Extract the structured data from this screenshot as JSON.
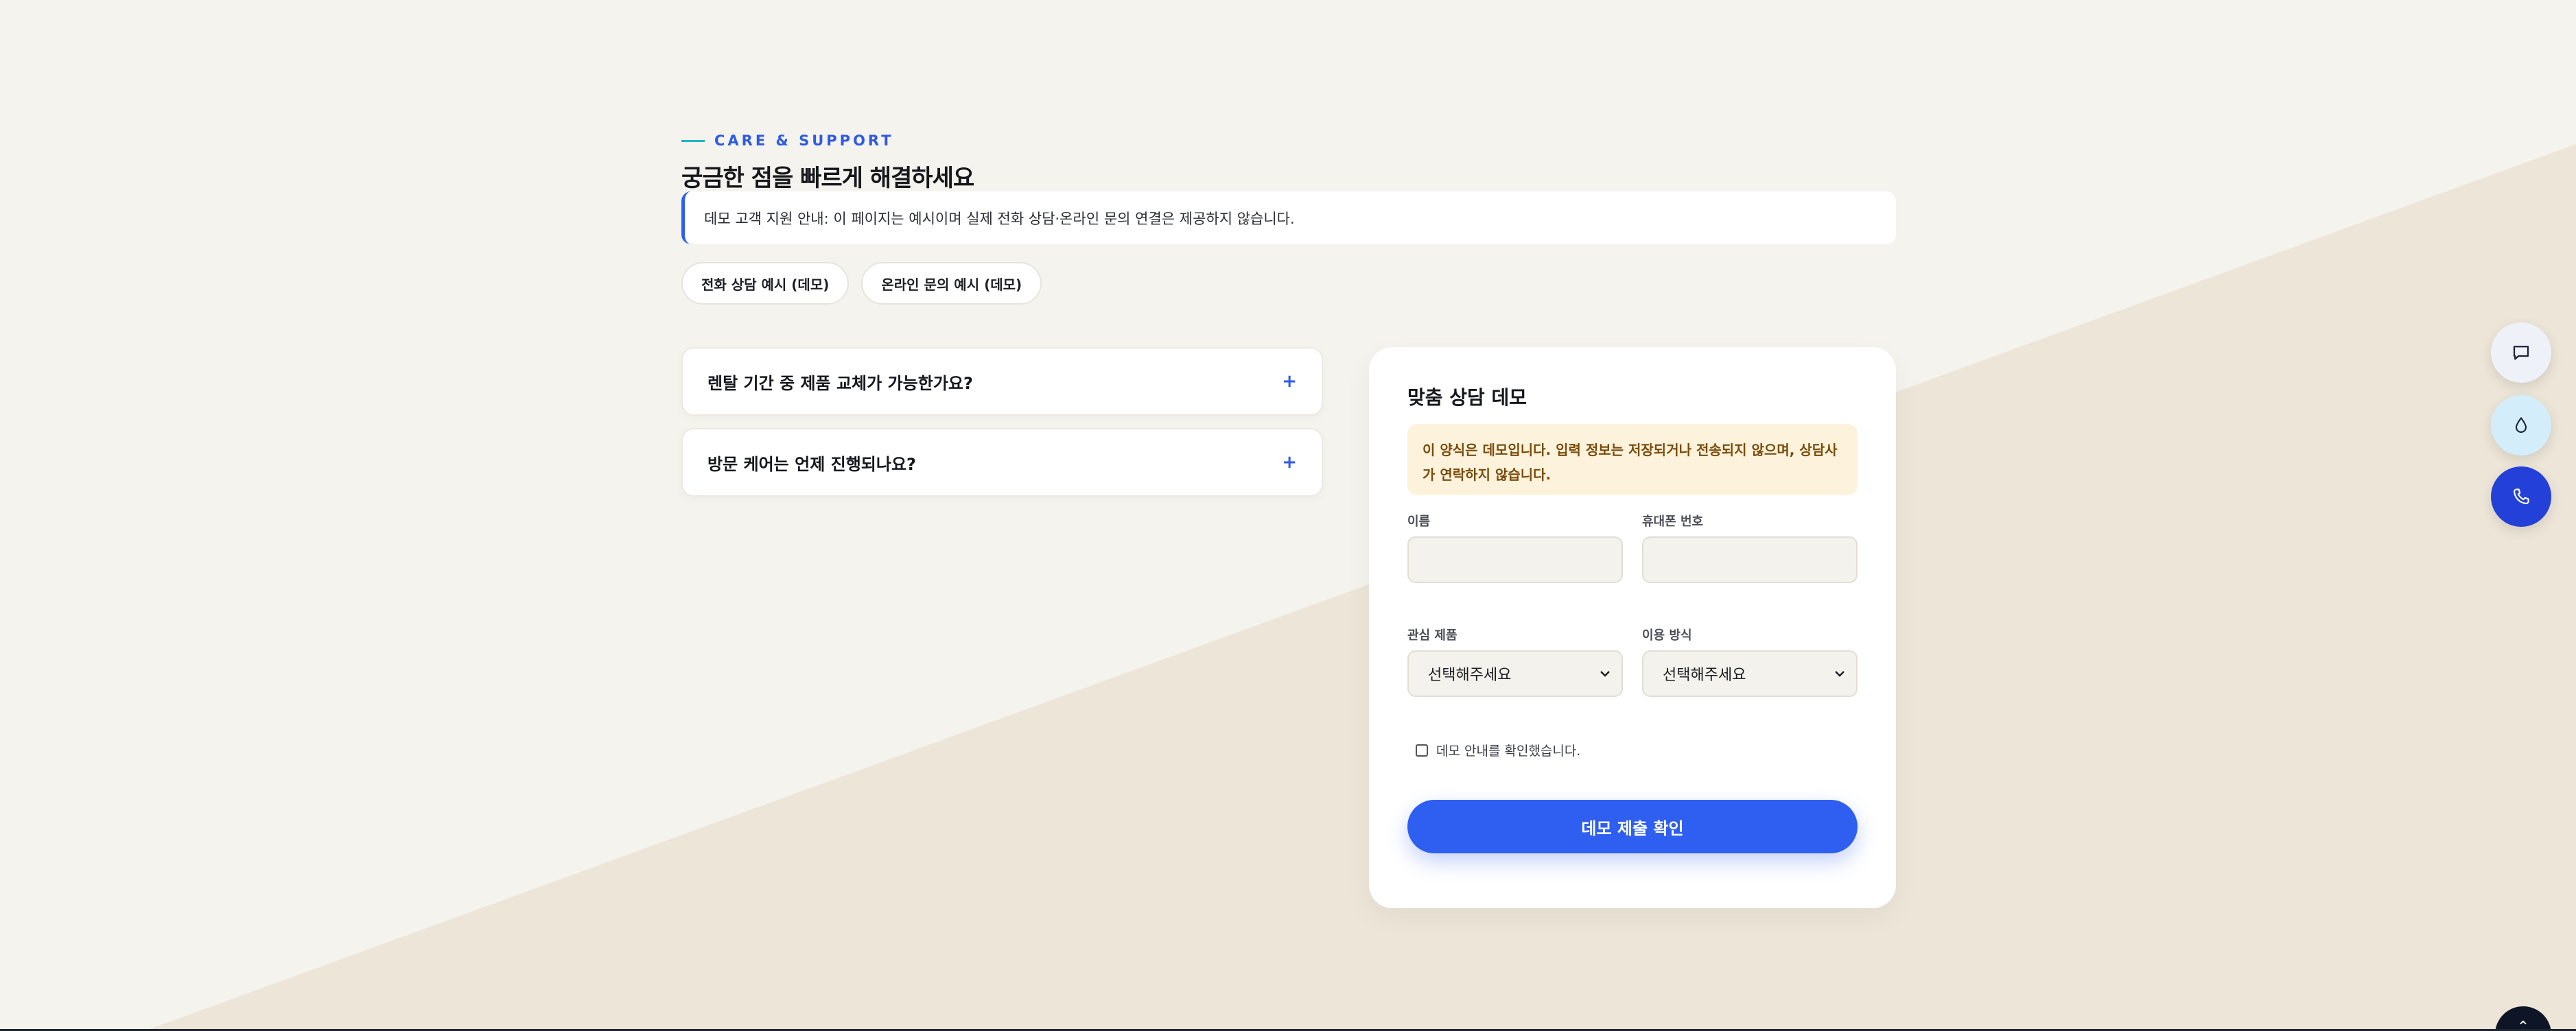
{
  "eyebrow": {
    "text": "CARE & SUPPORT"
  },
  "headline": "궁금한 점을 빠르게 해결하세요",
  "notice": "데모 고객 지원 안내: 이 페이지는 예시이며 실제 전화 상담·온라인 문의 연결은 제공하지 않습니다.",
  "chips": [
    {
      "label": "전화 상담 예시 (데모)"
    },
    {
      "label": "온라인 문의 예시 (데모)"
    }
  ],
  "faq": [
    {
      "question": "렌탈 기간 중 제품 교체가 가능한가요?",
      "toggle": "+"
    },
    {
      "question": "방문 케어는 언제 진행되나요?",
      "toggle": "+"
    }
  ],
  "form": {
    "title": "맞춤 상담 데모",
    "warning": "이 양식은 데모입니다. 입력 정보는 저장되거나 전송되지 않으며, 상담사가 연락하지 않습니다.",
    "name_label": "이름",
    "name_value": "",
    "phone_label": "휴대폰 번호",
    "phone_value": "",
    "product_label": "관심 제품",
    "product_value": "선택해주세요",
    "method_label": "이용 방식",
    "method_value": "선택해주세요",
    "confirm_label": "데모 안내를 확인했습니다.",
    "confirm_checked": false,
    "submit_label": "데모 제출 확인"
  },
  "floating_actions": [
    {
      "icon": "chat-icon"
    },
    {
      "icon": "water-drop-icon"
    },
    {
      "icon": "phone-icon"
    }
  ],
  "scroll_top": {
    "icon": "chevron-up-icon",
    "glyph": "⌃"
  },
  "colors": {
    "accent": "#2f5ff0",
    "eyebrow_line": "#22b3c9",
    "background": "#f5f3ee",
    "background_shape": "#ede6d8",
    "warning_bg": "#fdf3dc",
    "warning_text": "#7a4b0c"
  }
}
